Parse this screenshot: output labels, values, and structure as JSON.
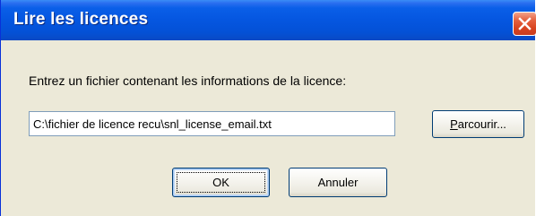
{
  "dialog": {
    "title": "Lire les licences",
    "prompt": "Entrez un fichier contenant les informations de la licence:",
    "file_path_value": "C:\\fichier de licence recu\\snl_license_email.txt",
    "browse_label_mnemonic": "P",
    "browse_label_rest": "arcourir...",
    "ok_label": "OK",
    "cancel_label": "Annuler"
  },
  "icons": {
    "close": "close-icon"
  },
  "colors": {
    "titlebar": "#0556e0",
    "client_background": "#ece9d8",
    "close_button": "#d8431f",
    "input_border": "#7f9db9",
    "button_border": "#003c74"
  }
}
